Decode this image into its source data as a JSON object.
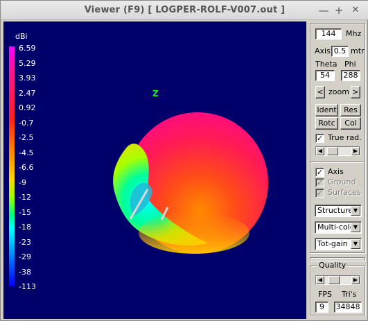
{
  "window": {
    "title": "Viewer (F9)     [ LOGPER-ROLF-V007.out ]",
    "min": "—",
    "max": "+",
    "close": "✕"
  },
  "viewer": {
    "unit": "dBi",
    "axis_label": "Z",
    "scale": [
      "6.59",
      "5.29",
      "3.93",
      "2.47",
      "0.92",
      "-0.7",
      "-2.5",
      "-4.5",
      "-6.6",
      "-9",
      "-12",
      "-15",
      "-18",
      "-23",
      "-29",
      "-38",
      "-113"
    ]
  },
  "controls": {
    "freq_value": "144",
    "freq_unit": "Mhz",
    "axis_label": "Axis",
    "axis_value": "0.5",
    "axis_unit": "mtr",
    "theta_label": "Theta",
    "phi_label": "Phi",
    "theta_value": "54",
    "phi_value": "288",
    "zoom_label": "zoom",
    "zoom_left": "<",
    "zoom_right": ">",
    "ident": "Ident",
    "res": "Res",
    "rotc": "Rotc",
    "col": "Col",
    "true_rad": "True rad.",
    "axis_chk": "Axis",
    "ground_chk": "Ground",
    "surfaces_chk": "Surfaces",
    "select_structure": "Structure",
    "select_multicolor": "Multi-colo",
    "select_totgain": "Tot-gain"
  },
  "quality": {
    "title": "Quality",
    "fps_label": "FPS",
    "tris_label": "Tri's",
    "fps_value": "9",
    "tris_value": "34848"
  }
}
